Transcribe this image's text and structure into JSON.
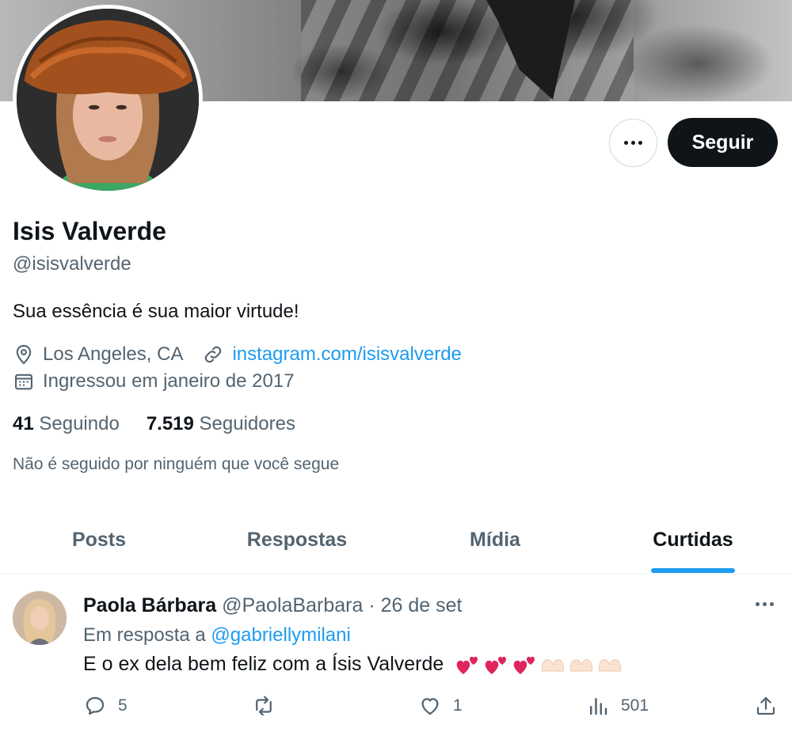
{
  "profile": {
    "name": "Isis Valverde",
    "handle": "@isisvalverde",
    "bio": "Sua essência é sua maior virtude!",
    "location": "Los Angeles, CA",
    "website": "instagram.com/isisvalverde",
    "joined": "Ingressou em janeiro de 2017",
    "following_count": "41",
    "following_label": "Seguindo",
    "followers_count": "7.519",
    "followers_label": "Seguidores",
    "not_followed_text": "Não é seguido por ninguém que você segue"
  },
  "actions": {
    "follow_label": "Seguir",
    "more_icon": "more-horizontal-icon"
  },
  "tabs": [
    {
      "label": "Posts",
      "active": false
    },
    {
      "label": "Respostas",
      "active": false
    },
    {
      "label": "Mídia",
      "active": false
    },
    {
      "label": "Curtidas",
      "active": true
    }
  ],
  "post": {
    "author_name": "Paola Bárbara",
    "author_handle": "@PaolaBarbara",
    "separator": "·",
    "date": "26 de set",
    "reply_prefix": "Em resposta a",
    "reply_to": "@gabriellymilani",
    "text": "E o ex dela bem feliz com a Ísis Valverde",
    "emoji_icons": [
      "two-hearts-icon",
      "two-hearts-icon",
      "two-hearts-icon",
      "heart-hands-icon",
      "heart-hands-icon",
      "heart-hands-icon"
    ],
    "replies": "5",
    "retweets": "",
    "likes": "1",
    "views": "501"
  },
  "colors": {
    "accent": "#1d9bf0",
    "text_primary": "#0f1419",
    "text_secondary": "#536471",
    "button_dark": "#0f1419",
    "heart_pink": "#e0245e"
  }
}
